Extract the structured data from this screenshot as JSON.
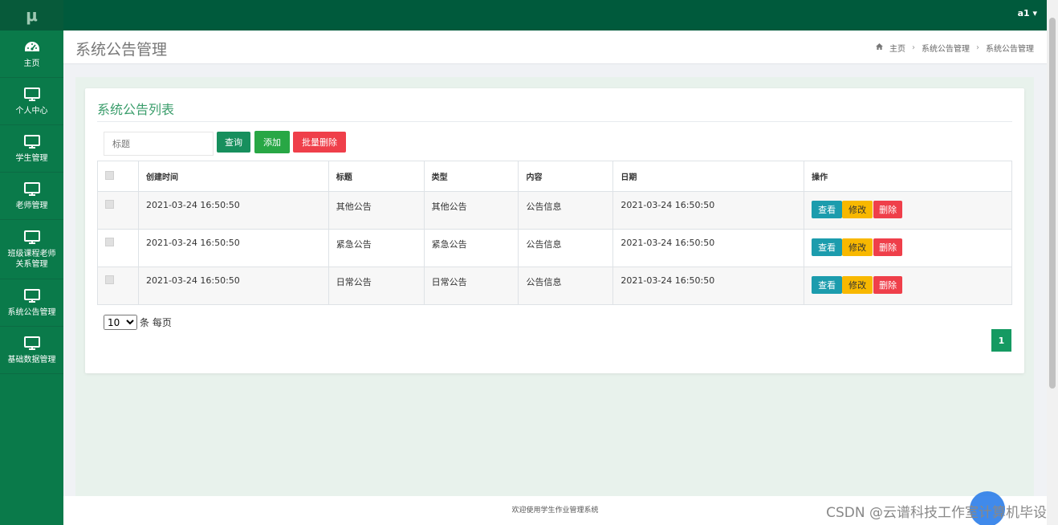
{
  "app": {
    "logo": "μ"
  },
  "sidebar": {
    "items": [
      {
        "label": "主页",
        "icon": "dashboard-icon"
      },
      {
        "label": "个人中心",
        "icon": "monitor-icon"
      },
      {
        "label": "学生管理",
        "icon": "monitor-icon"
      },
      {
        "label": "老师管理",
        "icon": "monitor-icon"
      },
      {
        "label": "班级课程老师关系管理",
        "icon": "monitor-icon"
      },
      {
        "label": "系统公告管理",
        "icon": "monitor-icon"
      },
      {
        "label": "基础数据管理",
        "icon": "monitor-icon"
      }
    ]
  },
  "topbar": {
    "user": "a1 ▾"
  },
  "header": {
    "title": "系统公告管理",
    "breadcrumb": [
      "主页",
      "系统公告管理",
      "系统公告管理"
    ]
  },
  "card": {
    "title": "系统公告列表",
    "search_placeholder": "标题",
    "btn_query": "查询",
    "btn_add": "添加",
    "btn_batch_delete": "批量删除"
  },
  "table": {
    "columns": [
      "创建时间",
      "标题",
      "类型",
      "内容",
      "日期",
      "操作"
    ],
    "rows": [
      {
        "created": "2021-03-24 16:50:50",
        "title": "其他公告",
        "type": "其他公告",
        "content": "公告信息",
        "date": "2021-03-24 16:50:50"
      },
      {
        "created": "2021-03-24 16:50:50",
        "title": "紧急公告",
        "type": "紧急公告",
        "content": "公告信息",
        "date": "2021-03-24 16:50:50"
      },
      {
        "created": "2021-03-24 16:50:50",
        "title": "日常公告",
        "type": "日常公告",
        "content": "公告信息",
        "date": "2021-03-24 16:50:50"
      }
    ],
    "actions": {
      "view": "查看",
      "edit": "修改",
      "delete": "删除"
    }
  },
  "pagination": {
    "page_size": "10",
    "page_size_suffix": "条 每页",
    "current_page": "1"
  },
  "footer": {
    "text": "欢迎使用学生作业管理系统",
    "watermark": "CSDN @云谱科技工作室计算机毕设"
  },
  "colors": {
    "sidebar": "#0a7a4a",
    "topbar": "#005a3c",
    "accent": "#3a9d6b",
    "danger": "#ef3f4a",
    "warning": "#f8b800",
    "info": "#1c9cad"
  }
}
